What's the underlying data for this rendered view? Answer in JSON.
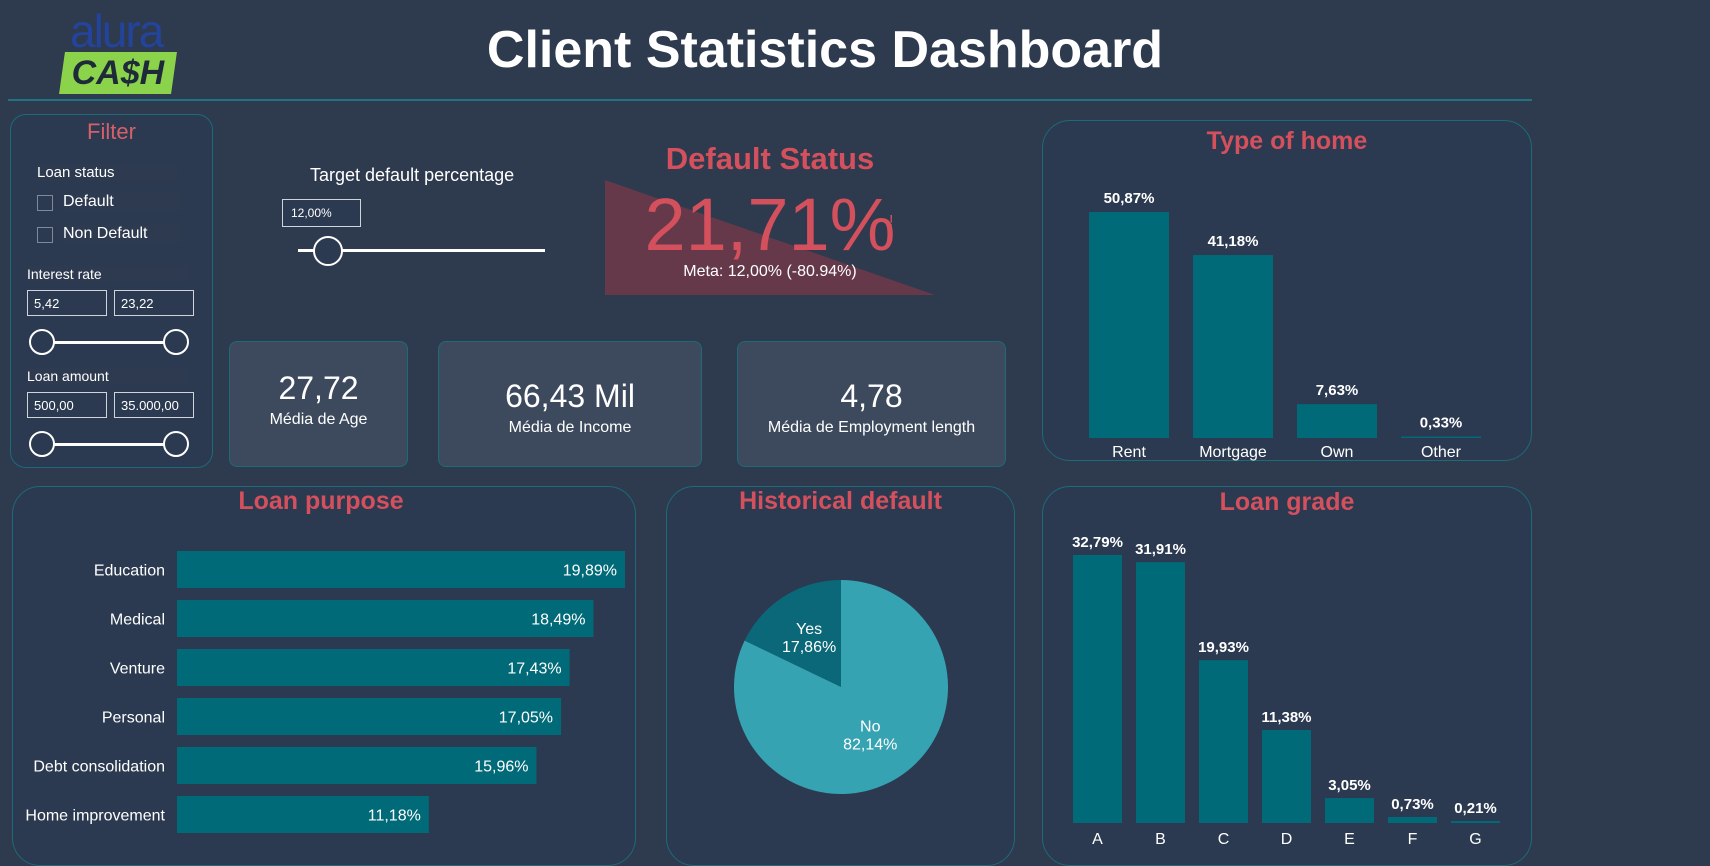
{
  "logo": {
    "top": "alura",
    "bottom": "CA$H"
  },
  "title": "Client Statistics Dashboard",
  "filter": {
    "title": "Filter",
    "loan_status_label": "Loan status",
    "options": [
      "Default",
      "Non Default"
    ],
    "interest_rate": {
      "label": "Interest rate",
      "min": "5,42",
      "max": "23,22"
    },
    "loan_amount": {
      "label": "Loan amount",
      "min": "500,00",
      "max": "35.000,00"
    }
  },
  "target": {
    "label": "Target default percentage",
    "value": "12,00%",
    "slider_fraction": 0.12
  },
  "default_status": {
    "title": "Default Status",
    "value": "21,71%",
    "alert": "!",
    "goal": "Meta: 12,00% (-80.94%)"
  },
  "cards": [
    {
      "value": "27,72",
      "label": "Média de Age"
    },
    {
      "value": "66,43 Mil",
      "label": "Média de Income"
    },
    {
      "value": "4,78",
      "label": "Média de Employment length"
    }
  ],
  "colors": {
    "bar": "#006a78",
    "pie_no": "#36a3b3",
    "pie_yes": "#0a6878",
    "accent_title": "#d4505d"
  },
  "chart_data": [
    {
      "id": "type_of_home",
      "type": "bar",
      "title": "Type of home",
      "categories": [
        "Rent",
        "Mortgage",
        "Own",
        "Other"
      ],
      "values": [
        50.87,
        41.18,
        7.63,
        0.33
      ],
      "labels": [
        "50,87%",
        "41,18%",
        "7,63%",
        "0,33%"
      ]
    },
    {
      "id": "loan_purpose",
      "type": "bar",
      "orientation": "horizontal",
      "title": "Loan purpose",
      "categories": [
        "Education",
        "Medical",
        "Venture",
        "Personal",
        "Debt consolidation",
        "Home improvement"
      ],
      "values": [
        19.89,
        18.49,
        17.43,
        17.05,
        15.96,
        11.18
      ],
      "labels": [
        "19,89%",
        "18,49%",
        "17,43%",
        "17,05%",
        "15,96%",
        "11,18%"
      ]
    },
    {
      "id": "historical_default",
      "type": "pie",
      "title": "Historical default",
      "categories": [
        "Yes",
        "No"
      ],
      "values": [
        17.86,
        82.14
      ],
      "labels": [
        "17,86%",
        "82,14%"
      ]
    },
    {
      "id": "loan_grade",
      "type": "bar",
      "title": "Loan grade",
      "categories": [
        "A",
        "B",
        "C",
        "D",
        "E",
        "F",
        "G"
      ],
      "values": [
        32.79,
        31.91,
        19.93,
        11.38,
        3.05,
        0.73,
        0.21
      ],
      "labels": [
        "32,79%",
        "31,91%",
        "19,93%",
        "11,38%",
        "3,05%",
        "0,73%",
        "0,21%"
      ]
    }
  ]
}
